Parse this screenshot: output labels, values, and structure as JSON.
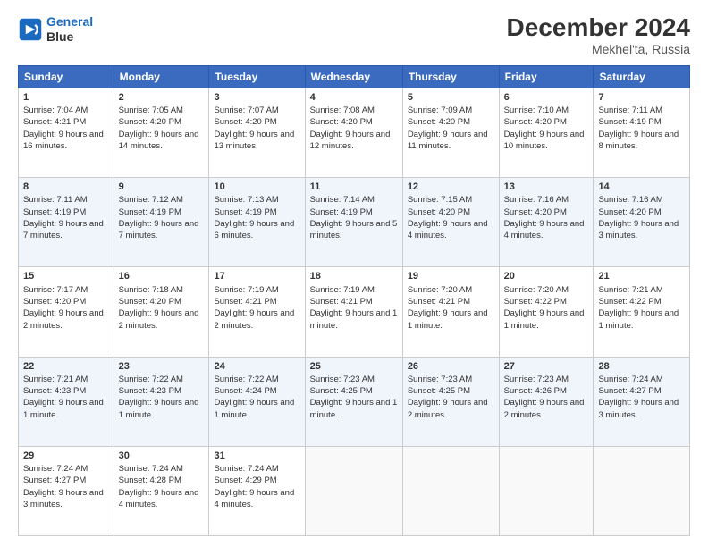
{
  "header": {
    "logo_line1": "General",
    "logo_line2": "Blue",
    "title": "December 2024",
    "subtitle": "Mekhel'ta, Russia"
  },
  "days_of_week": [
    "Sunday",
    "Monday",
    "Tuesday",
    "Wednesday",
    "Thursday",
    "Friday",
    "Saturday"
  ],
  "weeks": [
    [
      {
        "day": 1,
        "sunrise": "7:04 AM",
        "sunset": "4:21 PM",
        "daylight": "9 hours and 16 minutes."
      },
      {
        "day": 2,
        "sunrise": "7:05 AM",
        "sunset": "4:20 PM",
        "daylight": "9 hours and 14 minutes."
      },
      {
        "day": 3,
        "sunrise": "7:07 AM",
        "sunset": "4:20 PM",
        "daylight": "9 hours and 13 minutes."
      },
      {
        "day": 4,
        "sunrise": "7:08 AM",
        "sunset": "4:20 PM",
        "daylight": "9 hours and 12 minutes."
      },
      {
        "day": 5,
        "sunrise": "7:09 AM",
        "sunset": "4:20 PM",
        "daylight": "9 hours and 11 minutes."
      },
      {
        "day": 6,
        "sunrise": "7:10 AM",
        "sunset": "4:20 PM",
        "daylight": "9 hours and 10 minutes."
      },
      {
        "day": 7,
        "sunrise": "7:11 AM",
        "sunset": "4:19 PM",
        "daylight": "9 hours and 8 minutes."
      }
    ],
    [
      {
        "day": 8,
        "sunrise": "7:11 AM",
        "sunset": "4:19 PM",
        "daylight": "9 hours and 7 minutes."
      },
      {
        "day": 9,
        "sunrise": "7:12 AM",
        "sunset": "4:19 PM",
        "daylight": "9 hours and 7 minutes."
      },
      {
        "day": 10,
        "sunrise": "7:13 AM",
        "sunset": "4:19 PM",
        "daylight": "9 hours and 6 minutes."
      },
      {
        "day": 11,
        "sunrise": "7:14 AM",
        "sunset": "4:19 PM",
        "daylight": "9 hours and 5 minutes."
      },
      {
        "day": 12,
        "sunrise": "7:15 AM",
        "sunset": "4:20 PM",
        "daylight": "9 hours and 4 minutes."
      },
      {
        "day": 13,
        "sunrise": "7:16 AM",
        "sunset": "4:20 PM",
        "daylight": "9 hours and 4 minutes."
      },
      {
        "day": 14,
        "sunrise": "7:16 AM",
        "sunset": "4:20 PM",
        "daylight": "9 hours and 3 minutes."
      }
    ],
    [
      {
        "day": 15,
        "sunrise": "7:17 AM",
        "sunset": "4:20 PM",
        "daylight": "9 hours and 2 minutes."
      },
      {
        "day": 16,
        "sunrise": "7:18 AM",
        "sunset": "4:20 PM",
        "daylight": "9 hours and 2 minutes."
      },
      {
        "day": 17,
        "sunrise": "7:19 AM",
        "sunset": "4:21 PM",
        "daylight": "9 hours and 2 minutes."
      },
      {
        "day": 18,
        "sunrise": "7:19 AM",
        "sunset": "4:21 PM",
        "daylight": "9 hours and 1 minute."
      },
      {
        "day": 19,
        "sunrise": "7:20 AM",
        "sunset": "4:21 PM",
        "daylight": "9 hours and 1 minute."
      },
      {
        "day": 20,
        "sunrise": "7:20 AM",
        "sunset": "4:22 PM",
        "daylight": "9 hours and 1 minute."
      },
      {
        "day": 21,
        "sunrise": "7:21 AM",
        "sunset": "4:22 PM",
        "daylight": "9 hours and 1 minute."
      }
    ],
    [
      {
        "day": 22,
        "sunrise": "7:21 AM",
        "sunset": "4:23 PM",
        "daylight": "9 hours and 1 minute."
      },
      {
        "day": 23,
        "sunrise": "7:22 AM",
        "sunset": "4:23 PM",
        "daylight": "9 hours and 1 minute."
      },
      {
        "day": 24,
        "sunrise": "7:22 AM",
        "sunset": "4:24 PM",
        "daylight": "9 hours and 1 minute."
      },
      {
        "day": 25,
        "sunrise": "7:23 AM",
        "sunset": "4:25 PM",
        "daylight": "9 hours and 1 minute."
      },
      {
        "day": 26,
        "sunrise": "7:23 AM",
        "sunset": "4:25 PM",
        "daylight": "9 hours and 2 minutes."
      },
      {
        "day": 27,
        "sunrise": "7:23 AM",
        "sunset": "4:26 PM",
        "daylight": "9 hours and 2 minutes."
      },
      {
        "day": 28,
        "sunrise": "7:24 AM",
        "sunset": "4:27 PM",
        "daylight": "9 hours and 3 minutes."
      }
    ],
    [
      {
        "day": 29,
        "sunrise": "7:24 AM",
        "sunset": "4:27 PM",
        "daylight": "9 hours and 3 minutes."
      },
      {
        "day": 30,
        "sunrise": "7:24 AM",
        "sunset": "4:28 PM",
        "daylight": "9 hours and 4 minutes."
      },
      {
        "day": 31,
        "sunrise": "7:24 AM",
        "sunset": "4:29 PM",
        "daylight": "9 hours and 4 minutes."
      },
      null,
      null,
      null,
      null
    ]
  ]
}
